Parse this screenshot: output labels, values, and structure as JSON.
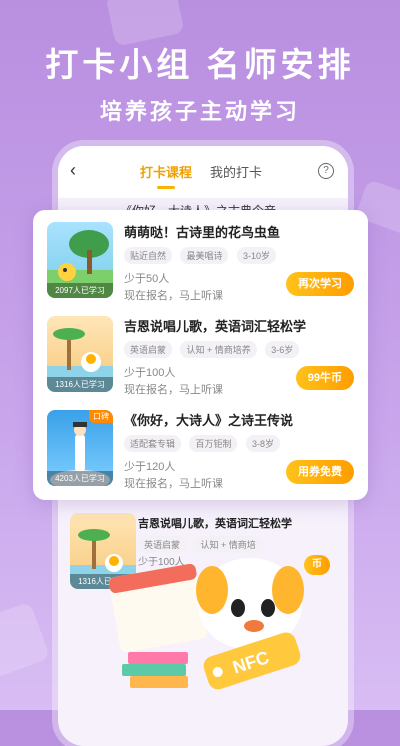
{
  "hero": {
    "headline": "打卡小组  名师安排",
    "subheadline": "培养孩子主动学习"
  },
  "phone": {
    "tabs": [
      {
        "label": "打卡课程",
        "active": true
      },
      {
        "label": "我的打卡",
        "active": false
      }
    ],
    "help_icon": "?",
    "background_row_title": "《你好，大诗人》之古典今音"
  },
  "courses": [
    {
      "title": "萌萌哒！古诗里的花鸟虫鱼",
      "tags": [
        "贴近自然",
        "最美唱诗",
        "3-10岁"
      ],
      "count_line": "少于50人",
      "status_line": "现在报名，马上听课",
      "thumb_caption": "2097人已学习",
      "button": "再次学习",
      "badge": ""
    },
    {
      "title": "吉恩说唱儿歌，英语词汇轻松学",
      "tags": [
        "英语启蒙",
        "认知 + 情商培养",
        "3-6岁"
      ],
      "count_line": "少于100人",
      "status_line": "现在报名，马上听课",
      "thumb_caption": "1316人已学习",
      "button": "99牛币",
      "badge": ""
    },
    {
      "title": "《你好，大诗人》之诗王传说",
      "tags": [
        "适配套专辑",
        "百万钜制",
        "3-8岁"
      ],
      "count_line": "少于120人",
      "status_line": "现在报名，马上听课",
      "thumb_caption": "4203人已学习",
      "button": "用券免费",
      "badge": "口碑"
    }
  ],
  "lower_course": {
    "title": "吉恩说唱儿歌，英语词汇轻松学",
    "tags": [
      "英语启蒙",
      "认知 + 情商培"
    ],
    "count_line": "少于100人",
    "thumb_caption": "1316人已学习",
    "button_partial": "币"
  },
  "mascot": {
    "tag_text": "NFC"
  },
  "colors": {
    "accent": "#f7b500",
    "background": "#c9a6ec"
  }
}
